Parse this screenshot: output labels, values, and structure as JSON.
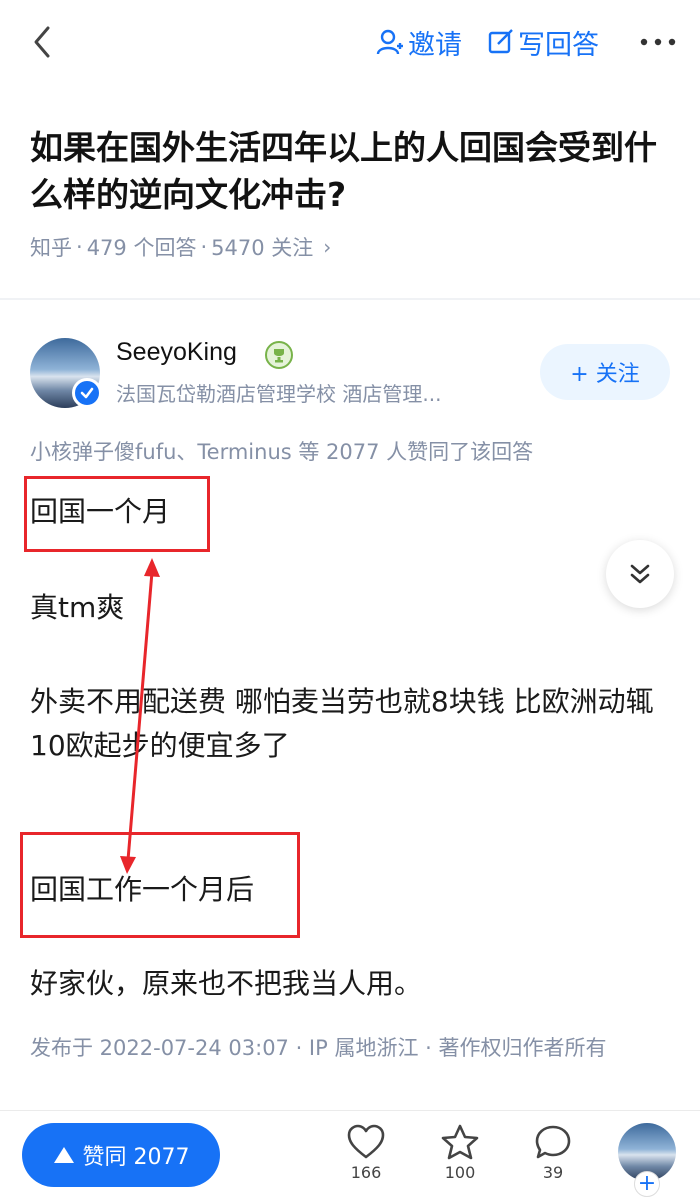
{
  "colors": {
    "brand": "#1772f6",
    "meta": "#8590a6",
    "annotation": "#e8262b",
    "text": "#1a1a1a"
  },
  "header": {
    "invite_label": "邀请",
    "write_answer_label": "写回答"
  },
  "question": {
    "title": "如果在国外生活四年以上的人回国会受到什么样的逆向文化冲击?",
    "source": "知乎",
    "answers": "479 个回答",
    "followers": "5470 关注"
  },
  "author": {
    "name": "SeeyoKing",
    "bio": "法国瓦岱勒酒店管理学校 酒店管理...",
    "follow_label": "+ 关注"
  },
  "answer": {
    "voters_text": "小核弹子傻fufu、Terminus 等 2077 人赞同了该回答",
    "paragraphs": [
      "回国一个月",
      "真tm爽",
      "外卖不用配送费 哪怕麦当劳也就8块钱 比欧洲动辄10欧起步的便宜多了",
      "回国工作一个月后",
      "好家伙，原来也不把我当人用。"
    ],
    "publish_info": "发布于 2022-07-24 03:07 · IP 属地浙江 · 著作权归作者所有"
  },
  "bottom_bar": {
    "agree_label": "赞同 2077",
    "like_count": "166",
    "favorite_count": "100",
    "comment_count": "39",
    "profile_plus": "+"
  }
}
